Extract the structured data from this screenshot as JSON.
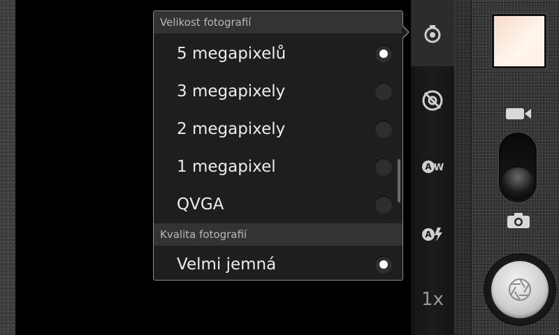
{
  "popup": {
    "sections": [
      {
        "header": "Velikost fotografií",
        "options": [
          {
            "label": "5 megapixelů",
            "selected": true
          },
          {
            "label": "3 megapixely",
            "selected": false
          },
          {
            "label": "2 megapixely",
            "selected": false
          },
          {
            "label": "1 megapixel",
            "selected": false
          },
          {
            "label": "QVGA",
            "selected": false
          }
        ]
      },
      {
        "header": "Kvalita fotografií",
        "options": [
          {
            "label": "Velmi jemná",
            "selected": true
          }
        ]
      }
    ]
  },
  "indicators": {
    "items": [
      {
        "icon": "picture-size-icon",
        "active": true
      },
      {
        "icon": "location-off-icon",
        "active": false
      },
      {
        "icon": "auto-white-balance-icon",
        "active": false
      },
      {
        "icon": "auto-flash-icon",
        "active": false
      }
    ],
    "zoom_label": "1x"
  },
  "controls": {
    "thumbnail_icon": "last-photo-thumbnail",
    "video_mode_icon": "video-camera-icon",
    "photo_mode_icon": "photo-camera-icon",
    "mode": "photo",
    "shutter_icon": "shutter-aperture-icon"
  }
}
